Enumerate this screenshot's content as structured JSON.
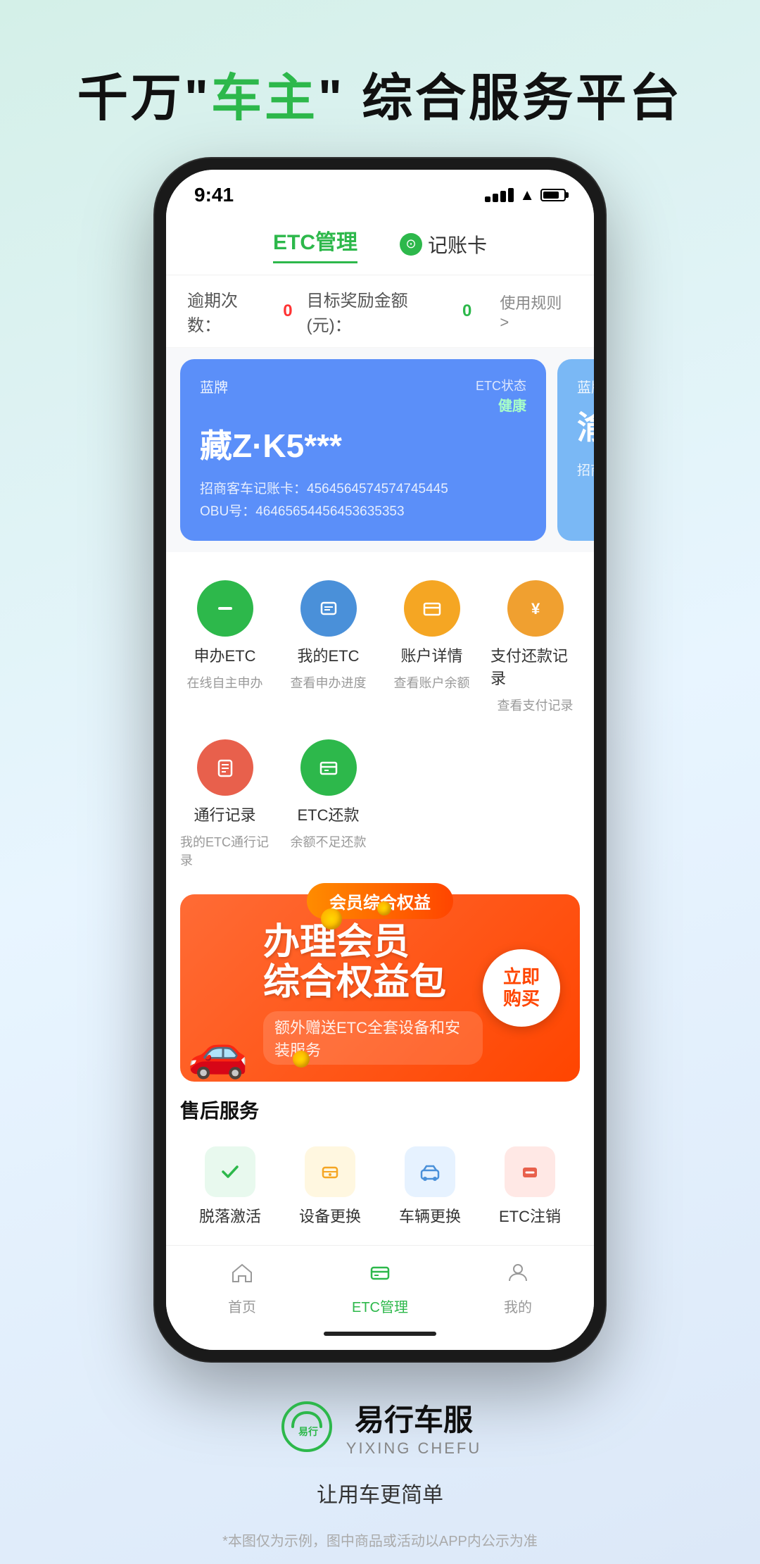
{
  "hero": {
    "title_part1": "千万",
    "title_quote_open": "\"",
    "title_highlight": "车主",
    "title_quote_close": "\"",
    "title_part2": "综合服务平台"
  },
  "phone": {
    "status_bar": {
      "time": "9:41",
      "signal": "signal",
      "wifi": "wifi",
      "battery": "battery"
    },
    "header": {
      "tab_etc": "ETC管理",
      "tab_account": "记账卡"
    },
    "stats": {
      "overdue_label": "逾期次数：",
      "overdue_value": "0",
      "reward_label": "目标奖励金额(元)：",
      "reward_value": "0",
      "rule_link": "使用规则 >"
    },
    "card1": {
      "label": "蓝牌",
      "status_label": "ETC状态",
      "status_value": "健康",
      "plate": "藏Z·K5***",
      "bank_label": "招商客车记账卡：",
      "bank_number": "4564564574574745445",
      "obu_label": "OBU号：",
      "obu_number": "46465654456453635353"
    },
    "card2": {
      "label": "蓝牌",
      "plate": "渝K...",
      "bank_label": "招商客..."
    },
    "services": [
      {
        "id": "apply-etc",
        "icon": "➖",
        "icon_bg": "icon-green",
        "name": "申办ETC",
        "desc": "在线自主申办"
      },
      {
        "id": "my-etc",
        "icon": "📋",
        "icon_bg": "icon-blue",
        "name": "我的ETC",
        "desc": "查看申办进度"
      },
      {
        "id": "account-detail",
        "icon": "💼",
        "icon_bg": "icon-yellow",
        "name": "账户详情",
        "desc": "查看账户余额"
      },
      {
        "id": "payment-record",
        "icon": "¥",
        "icon_bg": "icon-orange",
        "name": "支付还款记录",
        "desc": "查看支付记录"
      },
      {
        "id": "passage-record",
        "icon": "📝",
        "icon_bg": "icon-red-o",
        "name": "通行记录",
        "desc": "我的ETC通行记录"
      },
      {
        "id": "etc-repay",
        "icon": "💳",
        "icon_bg": "icon-green2",
        "name": "ETC还款",
        "desc": "余额不足还款"
      }
    ],
    "promo": {
      "tag": "会员综合权益",
      "main_line1": "办理会员",
      "main_line2": "综合权益包",
      "sub": "额外赠送ETC全套设备和安装服务",
      "buy_label": "立即\n购买"
    },
    "after_sales": {
      "title": "售后服务",
      "items": [
        {
          "id": "reactivate",
          "icon": "✓",
          "icon_bg": "after-bg-green",
          "icon_color": "#2db84b",
          "name": "脱落激活"
        },
        {
          "id": "device-replace",
          "icon": "⊟",
          "icon_bg": "after-bg-yellow",
          "icon_color": "#f5a623",
          "name": "设备更换"
        },
        {
          "id": "car-replace",
          "icon": "🚗",
          "icon_bg": "after-bg-blue",
          "icon_color": "#4a90d9",
          "name": "车辆更换"
        },
        {
          "id": "etc-cancel",
          "icon": "－",
          "icon_bg": "after-bg-red",
          "icon_color": "#e8604c",
          "name": "ETC注销"
        }
      ]
    },
    "bottom_nav": [
      {
        "id": "home",
        "icon": "🏠",
        "label": "首页",
        "active": false
      },
      {
        "id": "etc-manage",
        "icon": "💳",
        "label": "ETC管理",
        "active": true
      },
      {
        "id": "mine",
        "icon": "👤",
        "label": "我的",
        "active": false
      }
    ]
  },
  "brand": {
    "logo_text": "易行车服",
    "logo_en": "YIXING CHEFU",
    "slogan": "让用车更简单",
    "disclaimer": "*本图仅为示例，图中商品或活动以APP内公示为准"
  }
}
